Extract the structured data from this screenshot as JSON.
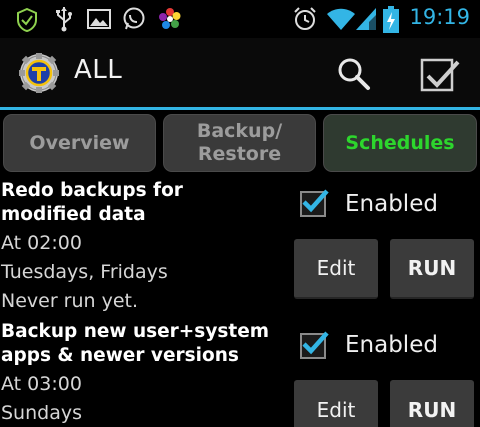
{
  "status_bar": {
    "time": "19:19",
    "left_icons": [
      "shield-icon",
      "usb-icon",
      "picture-icon",
      "whatsapp-icon",
      "flower-app-icon"
    ],
    "right_icons": [
      "alarm-icon",
      "wifi-icon",
      "signal-icon",
      "battery-charging-icon"
    ],
    "accent": "#33b5e5"
  },
  "action_bar": {
    "title": "ALL",
    "icons": [
      "titanium-backup-logo",
      "search-icon",
      "batch-check-icon"
    ]
  },
  "tabs": [
    {
      "label": "Overview",
      "active": false
    },
    {
      "label": "Backup/\nRestore",
      "active": false
    },
    {
      "label": "Schedules",
      "active": true
    }
  ],
  "schedules": [
    {
      "title": "Redo backups for modified data",
      "time": "At 02:00",
      "days": "Tuesdays, Fridays",
      "last_run": "Never run yet.",
      "enabled_label": "Enabled",
      "enabled": true,
      "edit_label": "Edit",
      "run_label": "RUN"
    },
    {
      "title": "Backup new user+system apps & newer versions",
      "time": "At 03:00",
      "days": "Sundays",
      "last_run": "",
      "enabled_label": "Enabled",
      "enabled": true,
      "edit_label": "Edit",
      "run_label": "RUN"
    }
  ]
}
